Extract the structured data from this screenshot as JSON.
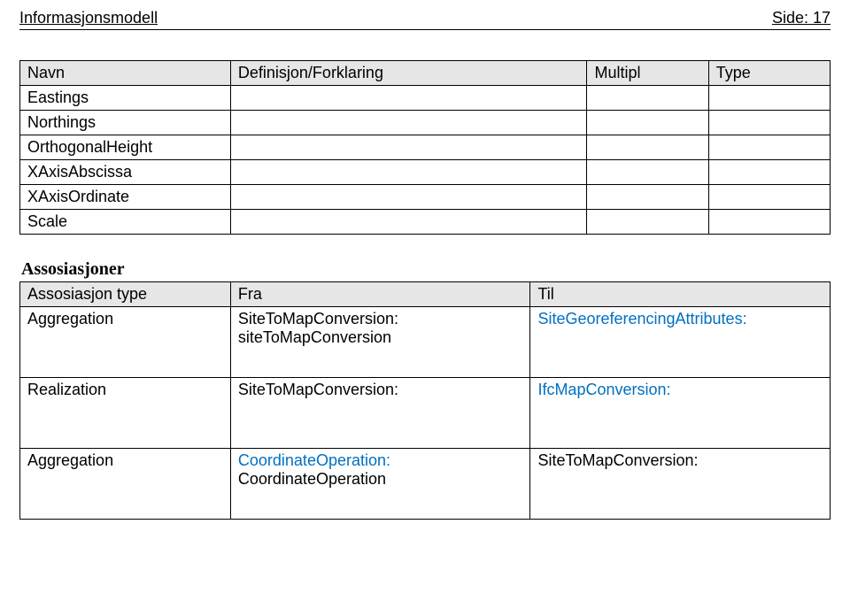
{
  "header": {
    "left": "Informasjonsmodell",
    "right": "Side: 17"
  },
  "mainTable": {
    "headers": {
      "navn": "Navn",
      "def": "Definisjon/Forklaring",
      "multipl": "Multipl",
      "type": "Type"
    },
    "rows": [
      {
        "navn": "Eastings",
        "def": "",
        "multipl": "",
        "type": ""
      },
      {
        "navn": "Northings",
        "def": "",
        "multipl": "",
        "type": ""
      },
      {
        "navn": "OrthogonalHeight",
        "def": "",
        "multipl": "",
        "type": ""
      },
      {
        "navn": "XAxisAbscissa",
        "def": "",
        "multipl": "",
        "type": ""
      },
      {
        "navn": "XAxisOrdinate",
        "def": "",
        "multipl": "",
        "type": ""
      },
      {
        "navn": "Scale",
        "def": "",
        "multipl": "",
        "type": ""
      }
    ]
  },
  "assocTitle": "Assosiasjoner",
  "assocTable": {
    "headers": {
      "type": "Assosiasjon type",
      "fra": "Fra",
      "til": "Til"
    },
    "rows": [
      {
        "type": "Aggregation",
        "fraPlain": "SiteToMapConversion: siteToMapConversion",
        "fraLink": "",
        "tilPlain": "",
        "tilLink": "SiteGeoreferencingAttributes:"
      },
      {
        "type": "Realization",
        "fraPlain": "SiteToMapConversion:",
        "fraLink": "",
        "tilPlain": "",
        "tilLink": "IfcMapConversion:"
      },
      {
        "type": "Aggregation",
        "fraPlain": "",
        "fraLink": "CoordinateOperation:",
        "fraSuffix": " CoordinateOperation",
        "tilPlain": "SiteToMapConversion:",
        "tilLink": ""
      }
    ]
  }
}
